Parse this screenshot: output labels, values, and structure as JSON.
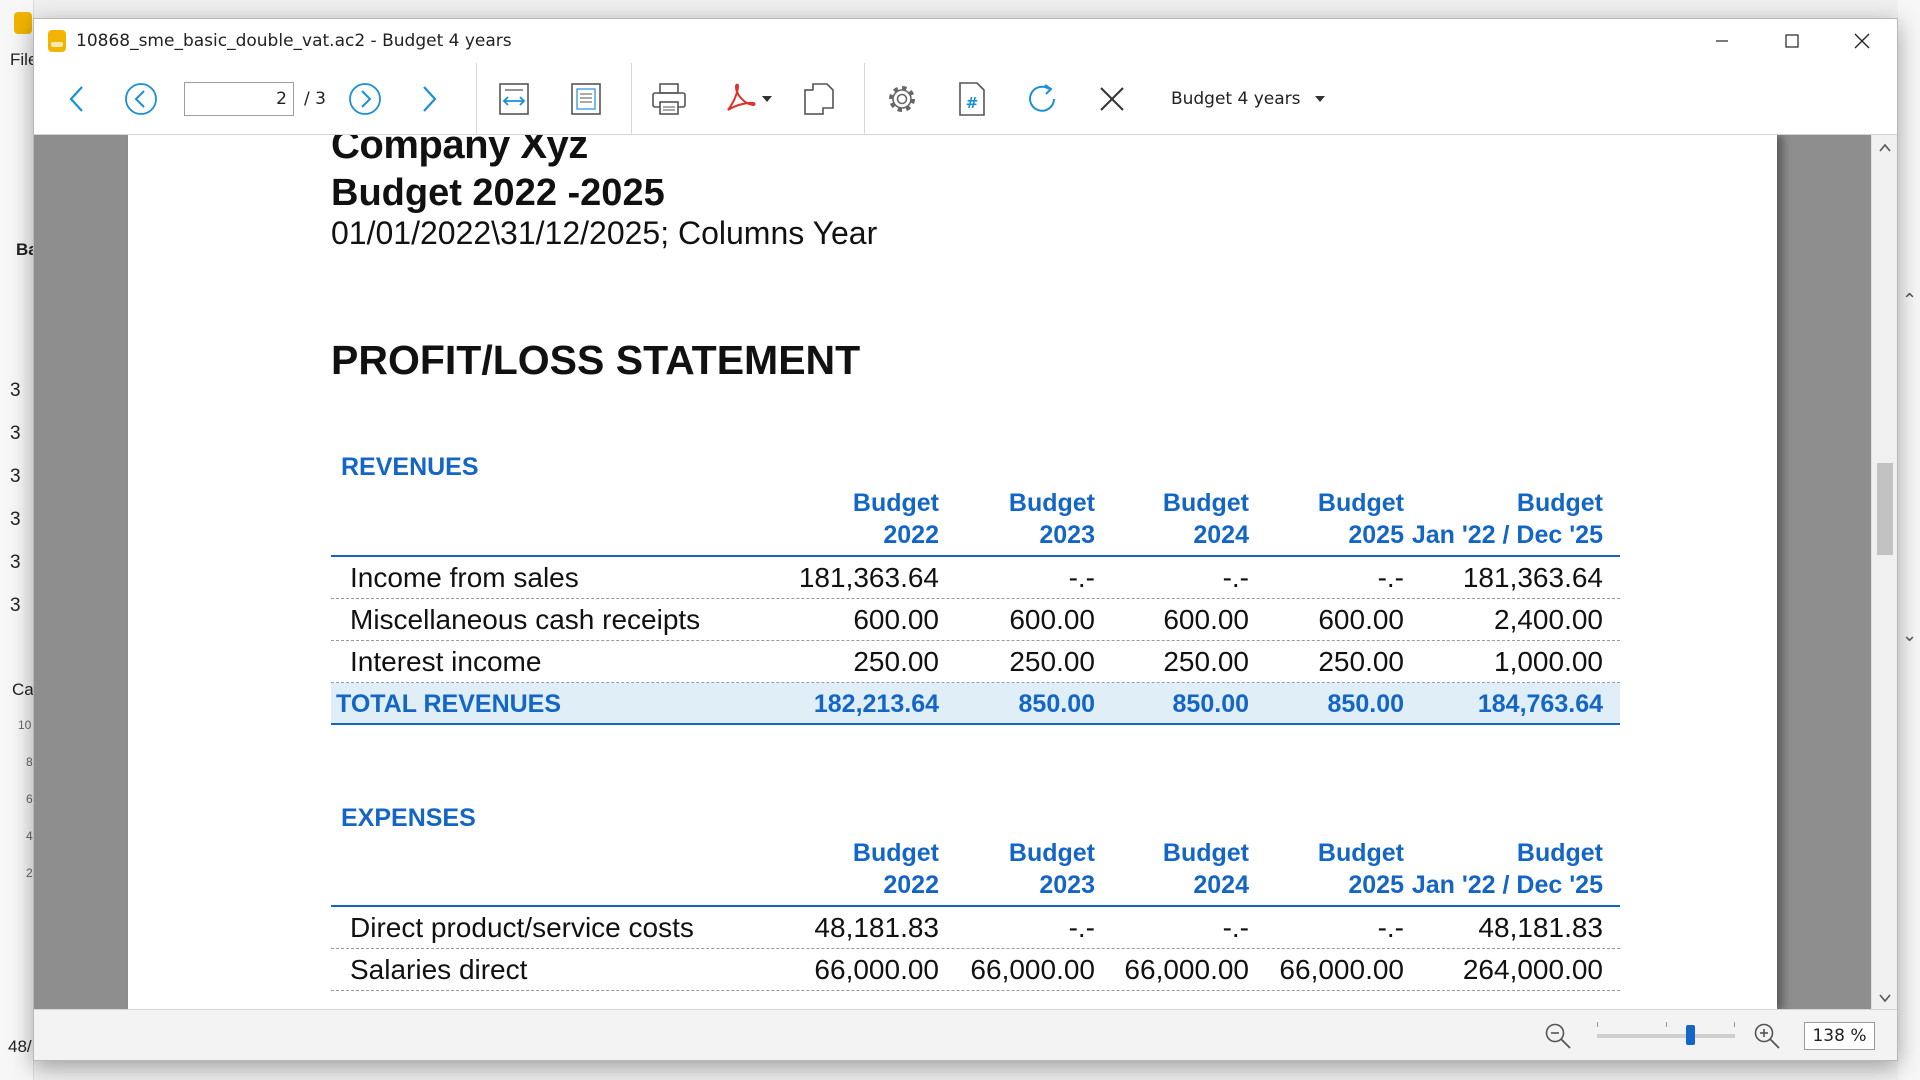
{
  "background_app": {
    "menu_file": "File",
    "side_label_b": "Ba",
    "side_label_c": "Ca",
    "side_rows": [
      "3",
      "3",
      "3",
      "3",
      "3",
      "3"
    ],
    "chart_ticks": [
      "10",
      "8",
      "6",
      "4",
      "2"
    ],
    "bottom_label": "48/"
  },
  "window": {
    "title": "10868_sme_basic_double_vat.ac2 - Budget 4 years",
    "controls": {
      "minimize_icon": "minimize-icon",
      "maximize_icon": "maximize-icon",
      "close_icon": "close-icon"
    }
  },
  "toolbar": {
    "page_current": "2",
    "page_total": "/ 3",
    "report_name": "Budget 4 years",
    "icons": [
      "back-arrow-icon",
      "prev-page-icon",
      "next-page-icon",
      "forward-arrow-icon",
      "fit-width-icon",
      "fit-page-icon",
      "print-icon",
      "pdf-icon",
      "copy-icon",
      "settings-icon",
      "page-number-icon",
      "refresh-icon",
      "close-icon"
    ]
  },
  "report": {
    "company": "Company Xyz",
    "budget_title": "Budget 2022 -2025",
    "period": "01/01/2022\\31/12/2025; Columns Year",
    "statement_title": "PROFIT/LOSS STATEMENT",
    "columns": [
      {
        "line1": "Budget",
        "line2": "2022"
      },
      {
        "line1": "Budget",
        "line2": "2023"
      },
      {
        "line1": "Budget",
        "line2": "2024"
      },
      {
        "line1": "Budget",
        "line2": "2025"
      },
      {
        "line1": "Budget",
        "line2": "Jan '22 / Dec '25"
      }
    ],
    "revenues": {
      "title": "REVENUES",
      "rows": [
        {
          "label": "Income from sales",
          "values": [
            "181,363.64",
            "-.-",
            "-.-",
            "-.-",
            "181,363.64"
          ]
        },
        {
          "label": "Miscellaneous cash receipts",
          "values": [
            "600.00",
            "600.00",
            "600.00",
            "600.00",
            "2,400.00"
          ]
        },
        {
          "label": "Interest income",
          "values": [
            "250.00",
            "250.00",
            "250.00",
            "250.00",
            "1,000.00"
          ]
        }
      ],
      "total": {
        "label": "TOTAL REVENUES",
        "values": [
          "182,213.64",
          "850.00",
          "850.00",
          "850.00",
          "184,763.64"
        ]
      }
    },
    "expenses": {
      "title": "EXPENSES",
      "rows": [
        {
          "label": "Direct product/service costs",
          "values": [
            "48,181.83",
            "-.-",
            "-.-",
            "-.-",
            "48,181.83"
          ]
        },
        {
          "label": "Salaries direct",
          "values": [
            "66,000.00",
            "66,000.00",
            "66,000.00",
            "66,000.00",
            "264,000.00"
          ]
        }
      ]
    }
  },
  "statusbar": {
    "zoom_level": "138 %",
    "zoom_slider_fraction": 0.68
  },
  "colors": {
    "accent_blue": "#1466c6",
    "total_row_bg": "#e0eef7",
    "viewer_bg": "#8e8e8e",
    "pdf_red": "#e0302a"
  }
}
